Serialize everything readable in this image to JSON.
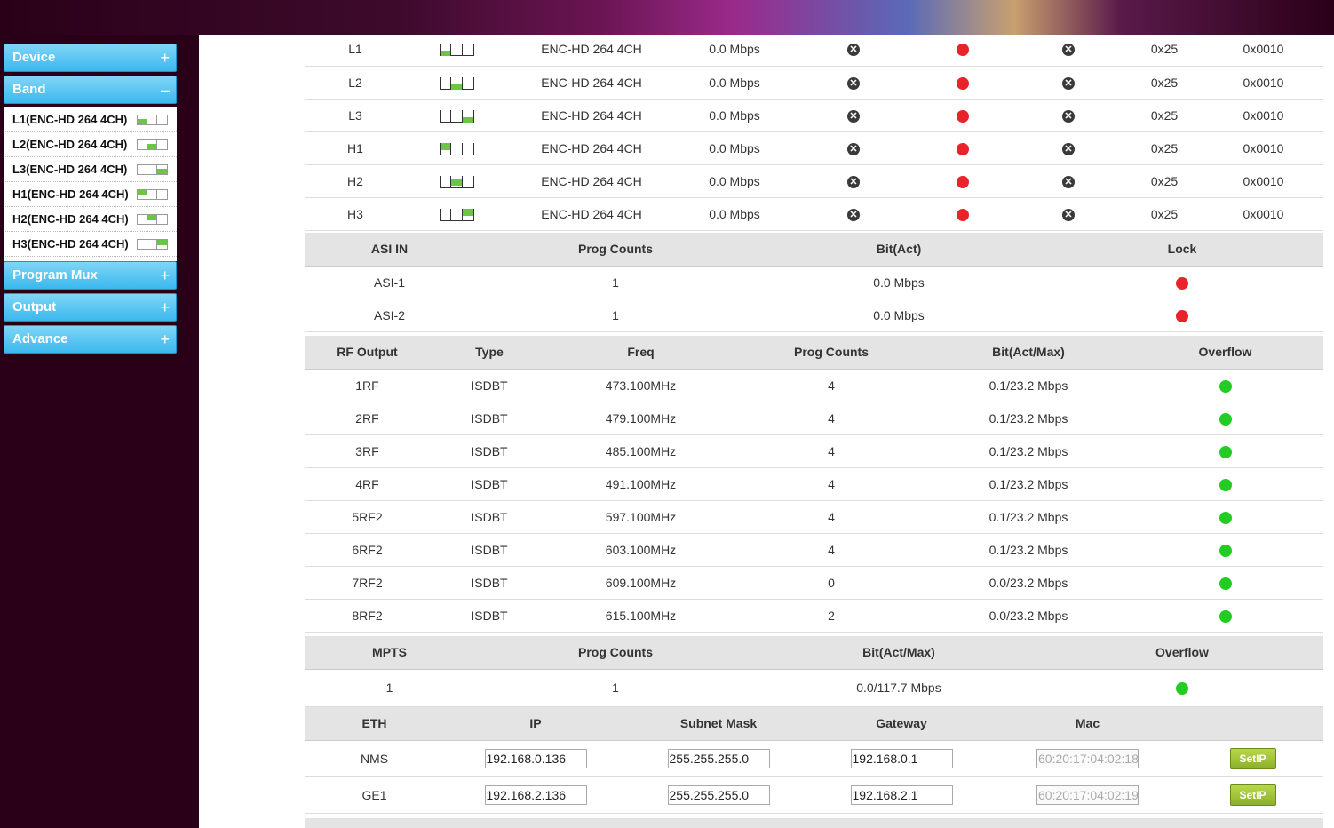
{
  "sidebar": {
    "device": {
      "label": "Device",
      "sign": "+"
    },
    "band": {
      "label": "Band",
      "sign": "–"
    },
    "band_items": [
      {
        "label": "L1(ENC-HD 264 4CH)"
      },
      {
        "label": "L2(ENC-HD 264 4CH)"
      },
      {
        "label": "L3(ENC-HD 264 4CH)"
      },
      {
        "label": "H1(ENC-HD 264 4CH)"
      },
      {
        "label": "H2(ENC-HD 264 4CH)"
      },
      {
        "label": "H3(ENC-HD 264 4CH)"
      }
    ],
    "program_mux": {
      "label": "Program Mux",
      "sign": "+"
    },
    "output": {
      "label": "Output",
      "sign": "+"
    },
    "advance": {
      "label": "Advance",
      "sign": "+"
    }
  },
  "band_rows": [
    {
      "name": "L1",
      "type": "ENC-HD 264 4CH",
      "bitrate": "0.0 Mbps",
      "pid1": "0x25",
      "pid2": "0x0010"
    },
    {
      "name": "L2",
      "type": "ENC-HD 264 4CH",
      "bitrate": "0.0 Mbps",
      "pid1": "0x25",
      "pid2": "0x0010"
    },
    {
      "name": "L3",
      "type": "ENC-HD 264 4CH",
      "bitrate": "0.0 Mbps",
      "pid1": "0x25",
      "pid2": "0x0010"
    },
    {
      "name": "H1",
      "type": "ENC-HD 264 4CH",
      "bitrate": "0.0 Mbps",
      "pid1": "0x25",
      "pid2": "0x0010"
    },
    {
      "name": "H2",
      "type": "ENC-HD 264 4CH",
      "bitrate": "0.0 Mbps",
      "pid1": "0x25",
      "pid2": "0x0010"
    },
    {
      "name": "H3",
      "type": "ENC-HD 264 4CH",
      "bitrate": "0.0 Mbps",
      "pid1": "0x25",
      "pid2": "0x0010"
    }
  ],
  "asi": {
    "headers": [
      "ASI IN",
      "Prog Counts",
      "Bit(Act)",
      "Lock"
    ],
    "rows": [
      {
        "name": "ASI-1",
        "counts": "1",
        "bit": "0.0 Mbps",
        "lock": "red"
      },
      {
        "name": "ASI-2",
        "counts": "1",
        "bit": "0.0 Mbps",
        "lock": "red"
      }
    ]
  },
  "rf": {
    "headers": [
      "RF Output",
      "Type",
      "Freq",
      "Prog Counts",
      "Bit(Act/Max)",
      "Overflow"
    ],
    "rows": [
      {
        "name": "1RF",
        "type": "ISDBT",
        "freq": "473.100MHz",
        "counts": "4",
        "bit": "0.1/23.2 Mbps"
      },
      {
        "name": "2RF",
        "type": "ISDBT",
        "freq": "479.100MHz",
        "counts": "4",
        "bit": "0.1/23.2 Mbps"
      },
      {
        "name": "3RF",
        "type": "ISDBT",
        "freq": "485.100MHz",
        "counts": "4",
        "bit": "0.1/23.2 Mbps"
      },
      {
        "name": "4RF",
        "type": "ISDBT",
        "freq": "491.100MHz",
        "counts": "4",
        "bit": "0.1/23.2 Mbps"
      },
      {
        "name": "5RF2",
        "type": "ISDBT",
        "freq": "597.100MHz",
        "counts": "4",
        "bit": "0.1/23.2 Mbps"
      },
      {
        "name": "6RF2",
        "type": "ISDBT",
        "freq": "603.100MHz",
        "counts": "4",
        "bit": "0.1/23.2 Mbps"
      },
      {
        "name": "7RF2",
        "type": "ISDBT",
        "freq": "609.100MHz",
        "counts": "0",
        "bit": "0.0/23.2 Mbps"
      },
      {
        "name": "8RF2",
        "type": "ISDBT",
        "freq": "615.100MHz",
        "counts": "2",
        "bit": "0.0/23.2 Mbps"
      }
    ]
  },
  "mpts": {
    "headers": [
      "MPTS",
      "Prog Counts",
      "Bit(Act/Max)",
      "Overflow"
    ],
    "rows": [
      {
        "name": "1",
        "counts": "1",
        "bit": "0.0/117.7 Mbps"
      }
    ]
  },
  "eth": {
    "headers": [
      "ETH",
      "IP",
      "Subnet Mask",
      "Gateway",
      "Mac"
    ],
    "setip_label": "SetIP",
    "rows": [
      {
        "name": "NMS",
        "ip": "192.168.0.136",
        "mask": "255.255.255.0",
        "gateway": "192.168.0.1",
        "mac": "60:20:17:04:02:18"
      },
      {
        "name": "GE1",
        "ip": "192.168.2.136",
        "mask": "255.255.255.0",
        "gateway": "192.168.2.1",
        "mac": "60:20:17:04:02:19"
      }
    ]
  },
  "colors": {
    "accent": "#3bb8ee",
    "ok": "#22cc22",
    "error": "#e8242a",
    "background": "#2a0018"
  }
}
